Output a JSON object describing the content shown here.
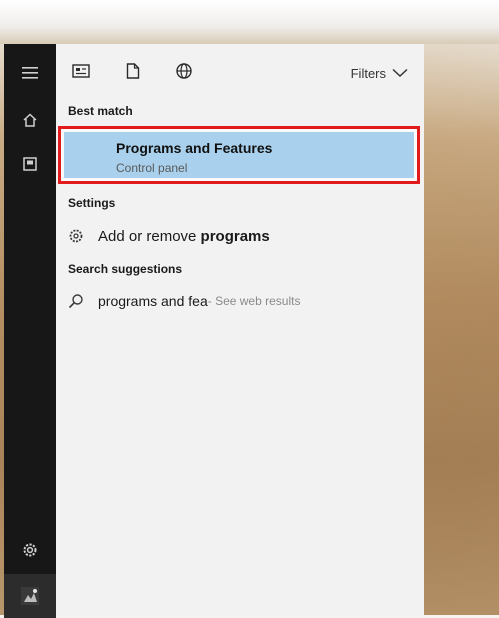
{
  "start_rail": {
    "items": [
      {
        "icon": "hamburger-icon"
      },
      {
        "icon": "home-icon"
      },
      {
        "icon": "document-icon"
      },
      {
        "icon": "gear-icon"
      },
      {
        "icon": "user-avatar-icon"
      }
    ]
  },
  "toolbar": {
    "icons": [
      "apps-icon",
      "documents-icon",
      "web-icon"
    ],
    "filters_label": "Filters"
  },
  "best_match": {
    "section_label": "Best match",
    "title": "Programs and Features",
    "subtitle": "Control panel",
    "highlight_color": "#e11b1b"
  },
  "settings": {
    "section_label": "Settings",
    "item_prefix": "Add or remove ",
    "item_bold": "programs"
  },
  "search_suggestions": {
    "section_label": "Search suggestions",
    "query": "programs and fea",
    "hint": " - See web results"
  }
}
